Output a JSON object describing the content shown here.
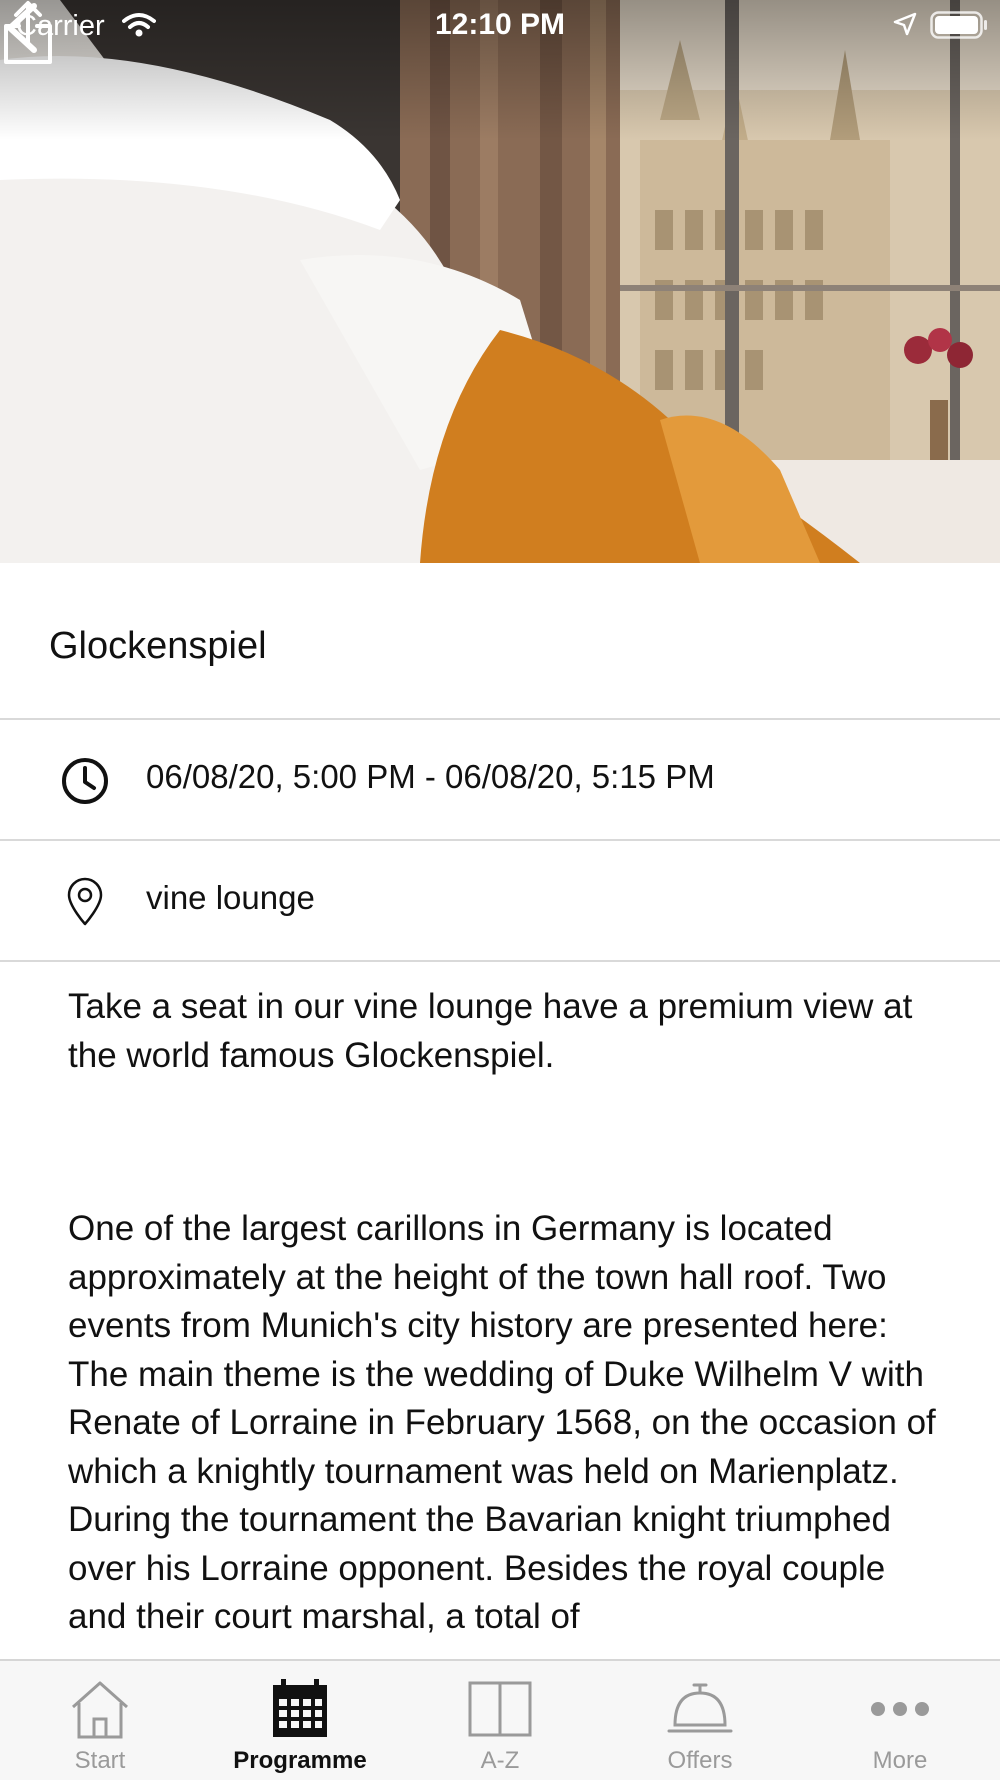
{
  "status_bar": {
    "carrier": "Carrier",
    "time": "12:10 PM"
  },
  "hero": {
    "icons": {
      "back": "chevron-left-icon",
      "share": "share-icon"
    }
  },
  "event": {
    "title": "Glockenspiel",
    "datetime": "06/08/20, 5:00 PM - 06/08/20, 5:15 PM",
    "location": "vine lounge",
    "description_intro": "Take a seat in our vine lounge have a premium view at the world famous Glockenspiel.",
    "description_body": "One of the largest carillons in Germany is located approximately at the height of the town hall roof. Two events from Munich's city history are presented here: The main theme is the wedding of Duke Wilhelm V with Renate of Lorraine in February 1568, on the occasion of which a knightly tournament was held on Marienplatz. During the tournament the Bavarian knight triumphed over his Lorraine opponent. Besides the royal couple and their court marshal, a total of"
  },
  "tabbar": {
    "tabs": [
      {
        "label": "Start",
        "icon": "house-icon",
        "active": false
      },
      {
        "label": "Programme",
        "icon": "calendar-icon",
        "active": true
      },
      {
        "label": "A-Z",
        "icon": "book-icon",
        "active": false
      },
      {
        "label": "Offers",
        "icon": "service-bell-icon",
        "active": false
      },
      {
        "label": "More",
        "icon": "more-dots-icon",
        "active": false
      }
    ]
  },
  "colors": {
    "active_tab": "#111111",
    "inactive_tab": "#9a9a9a",
    "divider": "#d9d9d9"
  }
}
